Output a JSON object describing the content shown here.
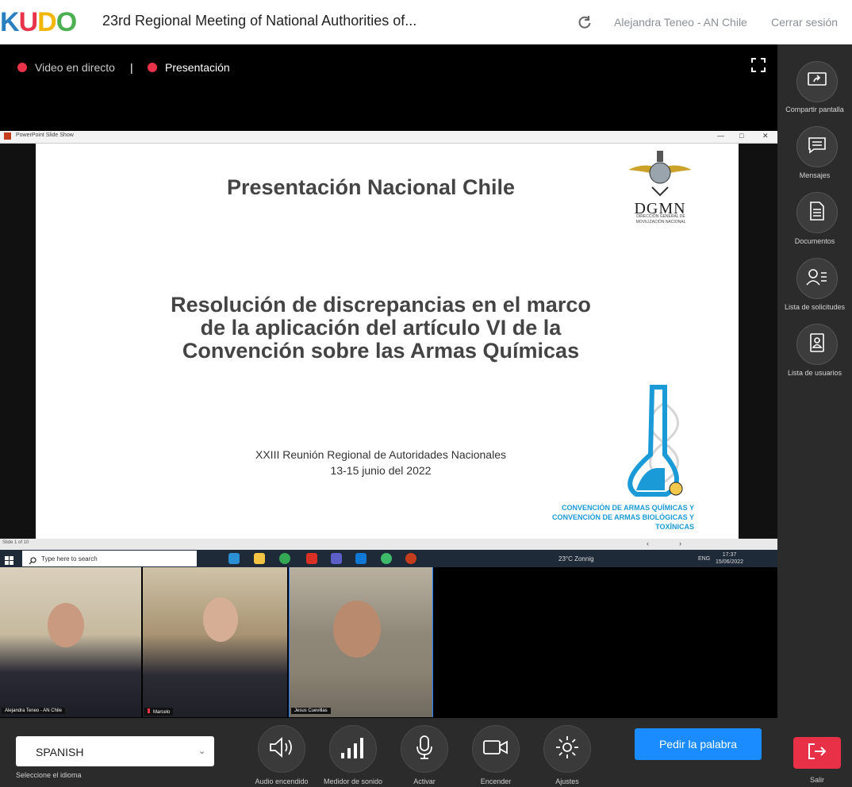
{
  "header": {
    "logo_letters": [
      "K",
      "U",
      "D",
      "O"
    ],
    "logo_colors": [
      "#2a7fc1",
      "#e8334a",
      "#f2b705",
      "#4caf50"
    ],
    "meeting_title": "23rd Regional Meeting of National Authorities of...",
    "user_name": "Alejandra Teneo - AN Chile",
    "logout_label": "Cerrar sesión"
  },
  "stage_tabs": {
    "live_label": "Video en directo",
    "separator": "|",
    "presentation_label": "Presentación"
  },
  "ppt_window": {
    "title": "PowerPoint Slide Show",
    "slide_number": "Slide 1 of 10",
    "slide": {
      "title": "Presentación Nacional Chile",
      "subtitle": "Resolución de discrepancias en el marco  de la aplicación del artículo VI de la Convención sobre las Armas Químicas",
      "event_line1": "XXIII Reunión Regional de Autoridades Nacionales",
      "event_line2": "13-15 junio del 2022",
      "org_abbrev": "DGMN",
      "org_full": "DIRECCIÓN GENERAL DE MOVILIZACIÓN NACIONAL",
      "convention_line1": "CONVENCIÓN DE ARMAS QUÍMICAS Y",
      "convention_line2": "CONVENCIÓN DE ARMAS BIOLÓGICAS Y TOXÍNICAS"
    }
  },
  "taskbar": {
    "search_placeholder": "Type here to search",
    "weather": "23°C  Zonnig",
    "language": "ENG",
    "time": "17:37",
    "date": "15/06/2022"
  },
  "participants": [
    {
      "name": "Alejandra Teneo - AN Chile"
    },
    {
      "name": "Marcelo"
    },
    {
      "name": "Jesus Cuevillas"
    }
  ],
  "sidebar": {
    "items": [
      {
        "label": "Compartir pantalla",
        "icon": "share-screen-icon"
      },
      {
        "label": "Mensajes",
        "icon": "message-icon"
      },
      {
        "label": "Documentos",
        "icon": "document-icon"
      },
      {
        "label": "Lista de solicitudes",
        "icon": "request-list-icon"
      },
      {
        "label": "Lista de usuarios",
        "icon": "user-list-icon"
      }
    ],
    "exit_label": "Salir"
  },
  "bottombar": {
    "language_value": "SPANISH",
    "language_label": "Seleccione el idioma",
    "controls": [
      {
        "label": "Audio encendido",
        "icon": "speaker-icon"
      },
      {
        "label": "Medidor de sonido",
        "icon": "sound-meter-icon"
      },
      {
        "label": "Activar",
        "icon": "microphone-icon"
      },
      {
        "label": "Encender",
        "icon": "camera-icon"
      },
      {
        "label": "Ajustes",
        "icon": "settings-icon"
      }
    ],
    "floor_button": "Pedir la palabra"
  },
  "colors": {
    "accent_blue": "#1a8cff",
    "live_dot": "#e8334a",
    "exit_red": "#e83047",
    "sidebar_bg": "#2b2b2b"
  }
}
